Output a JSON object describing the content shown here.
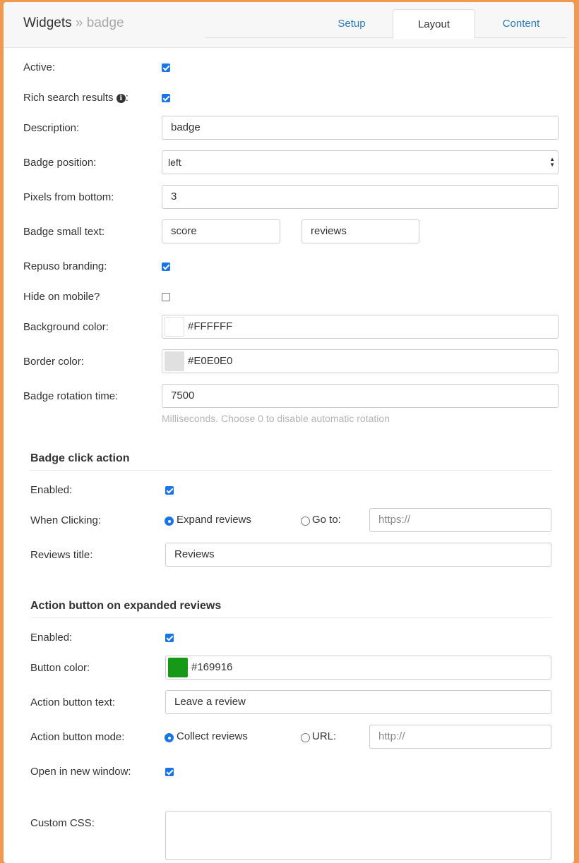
{
  "header": {
    "breadcrumb_root": "Widgets",
    "breadcrumb_sep": "»",
    "breadcrumb_current": "badge",
    "tabs": [
      "Setup",
      "Layout",
      "Content"
    ],
    "active_tab": "Layout"
  },
  "general": {
    "active_label": "Active:",
    "active_checked": true,
    "rich_label": "Rich search results",
    "rich_colon": ":",
    "rich_checked": true,
    "description_label": "Description:",
    "description_value": "badge",
    "position_label": "Badge position:",
    "position_value": "left",
    "pixels_label": "Pixels from bottom:",
    "pixels_value": "3",
    "small_text_label": "Badge small text:",
    "small_text_1": "score",
    "small_text_2": "reviews",
    "branding_label": "Repuso branding:",
    "branding_checked": true,
    "hide_mobile_label": "Hide on mobile?",
    "hide_mobile_checked": false,
    "bg_label": "Background color:",
    "bg_value": "#FFFFFF",
    "bg_swatch": "#FFFFFF",
    "border_label": "Border color:",
    "border_value": "#E0E0E0",
    "border_swatch": "#E0E0E0",
    "rotation_label": "Badge rotation time:",
    "rotation_value": "7500",
    "rotation_help": "Milliseconds. Choose 0 to disable automatic rotation"
  },
  "click_action": {
    "title": "Badge click action",
    "enabled_label": "Enabled:",
    "enabled_checked": true,
    "when_label": "When Clicking:",
    "option_expand": "Expand reviews",
    "option_goto": "Go to:",
    "selected": "expand",
    "goto_placeholder": "https://",
    "reviews_title_label": "Reviews title:",
    "reviews_title_value": "Reviews"
  },
  "action_button": {
    "title": "Action button on expanded reviews",
    "enabled_label": "Enabled:",
    "enabled_checked": true,
    "color_label": "Button color:",
    "color_value": "#169916",
    "color_swatch": "#169916",
    "text_label": "Action button text:",
    "text_value": "Leave a review",
    "mode_label": "Action button mode:",
    "option_collect": "Collect reviews",
    "option_url": "URL:",
    "selected": "collect",
    "url_placeholder": "http://",
    "new_window_label": "Open in new window:",
    "new_window_checked": true
  },
  "custom_css": {
    "label": "Custom CSS:"
  },
  "icons": {
    "rich_info": "info-circle-icon"
  }
}
